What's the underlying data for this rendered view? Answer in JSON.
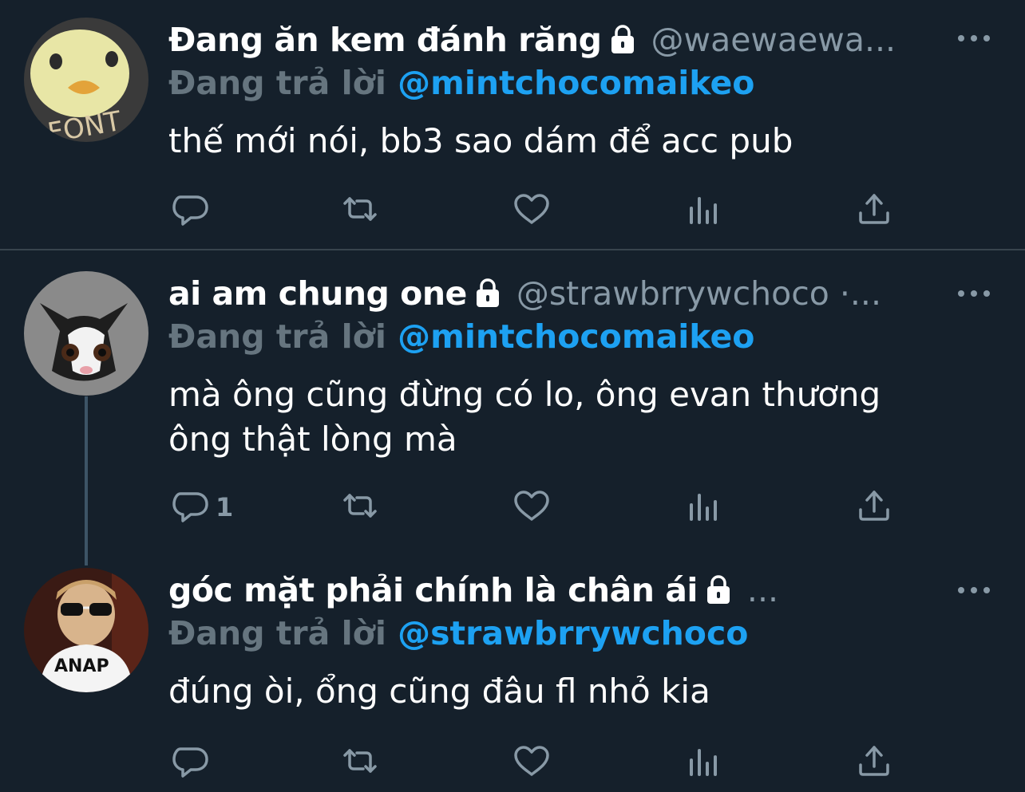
{
  "icons": {
    "reply": "reply-icon",
    "retweet": "retweet-icon",
    "like": "heart-icon",
    "analytics": "analytics-icon",
    "share": "share-icon",
    "lock": "lock-icon",
    "more": "more-icon"
  },
  "colors": {
    "background": "#15202b",
    "accent": "#1da1f2",
    "muted": "#8899a6",
    "divider": "#38444d"
  },
  "tweets": [
    {
      "name": "Đang ăn kem đánh răng",
      "handle": "@waewaewa...",
      "reply_prefix": "Đang trả lời",
      "reply_to": "@mintchocomaikeo",
      "text": "thế mới nói, bb3 sao dám để acc pub",
      "reply_count": ""
    },
    {
      "name": "ai am chung one",
      "handle": "@strawbrrywchoco ·...",
      "reply_prefix": "Đang trả lời",
      "reply_to": "@mintchocomaikeo",
      "text": "mà ông cũng đừng có lo, ông evan thương ông thật lòng mà",
      "reply_count": "1"
    },
    {
      "name": "góc mặt phải chính là chân ái",
      "handle": "...",
      "reply_prefix": "Đang trả lời",
      "reply_to": "@strawbrrywchoco",
      "text": "đúng òi, ổng cũng đâu fl nhỏ kia",
      "reply_count": ""
    }
  ]
}
